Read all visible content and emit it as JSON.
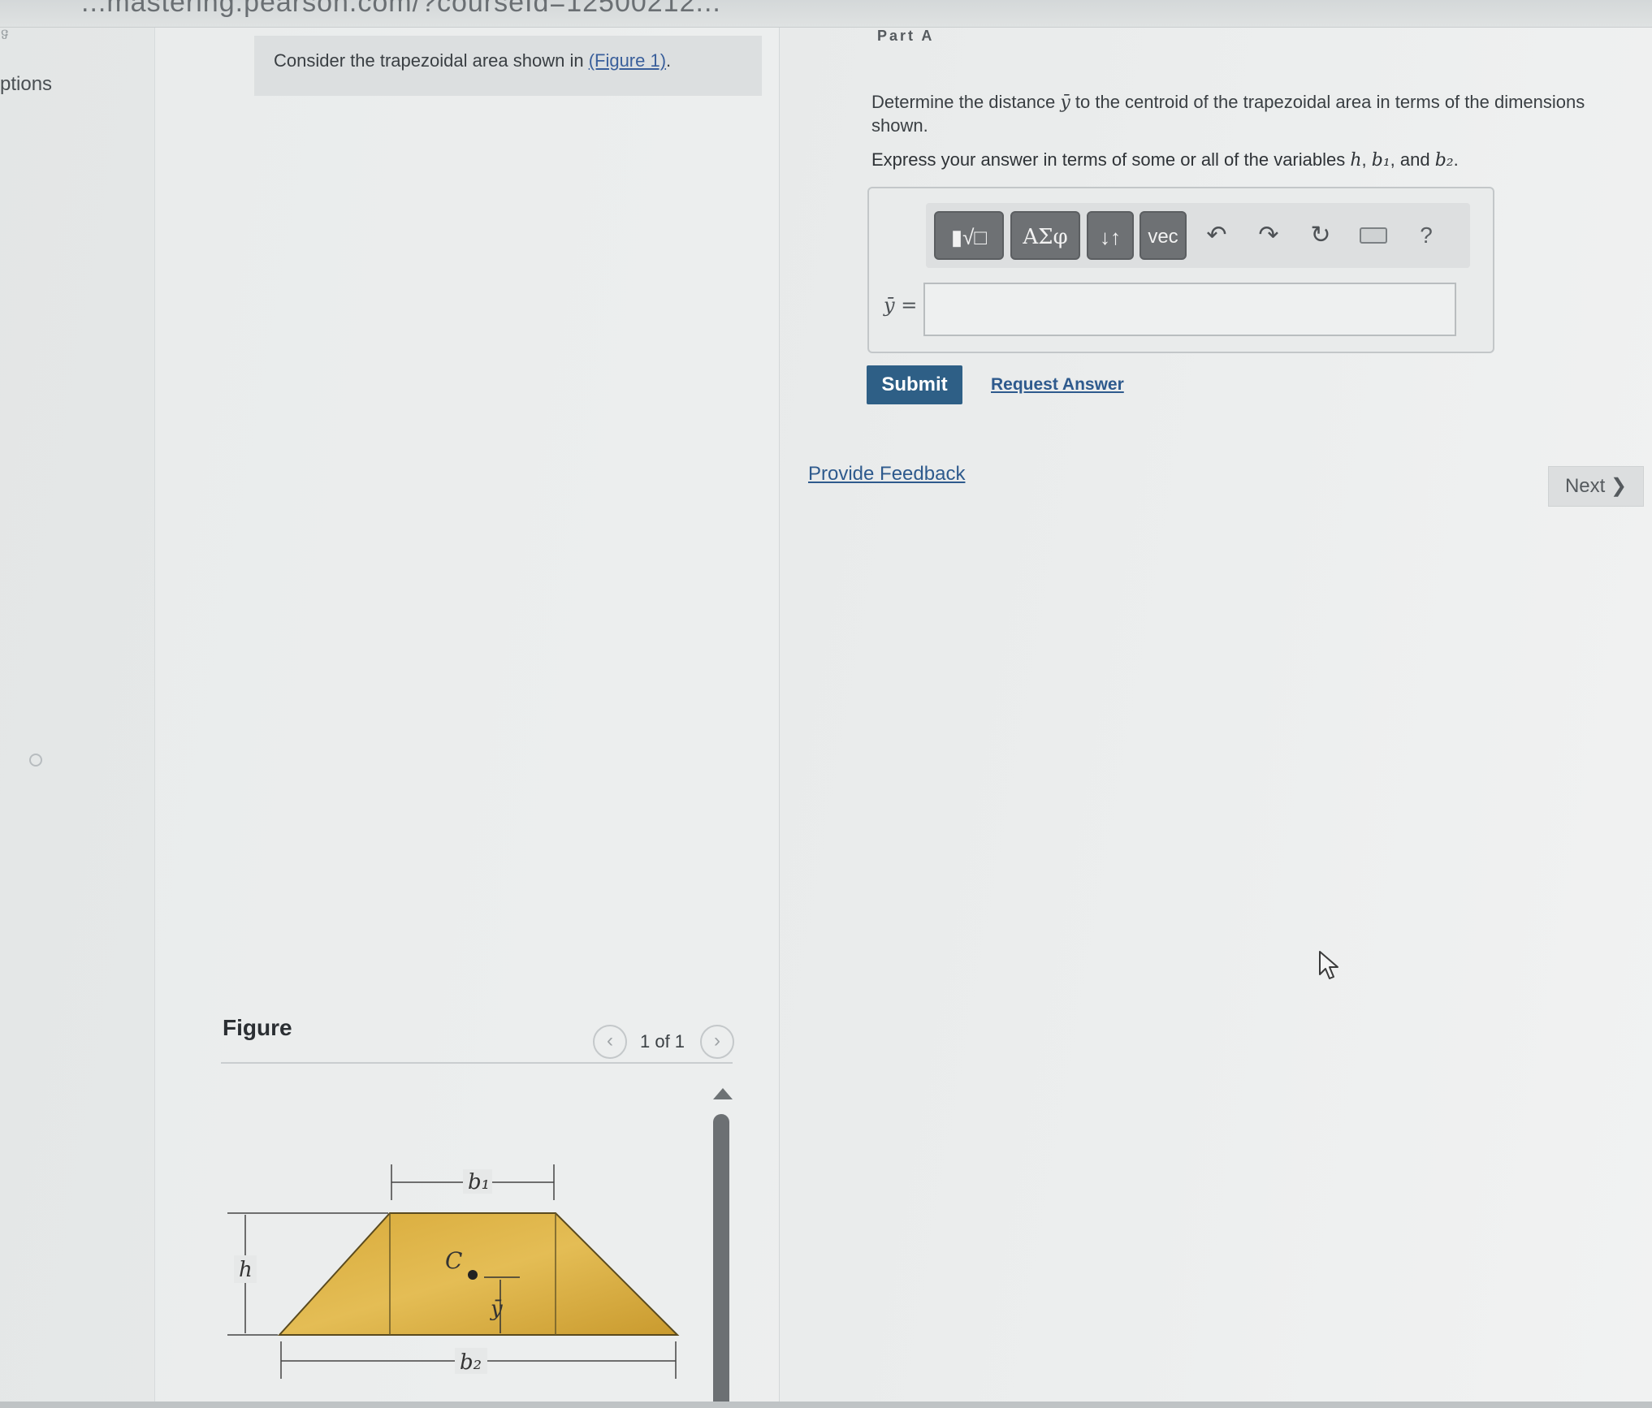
{
  "browser": {
    "url_fragment": "...mastering.pearson.com/?courseId=12500212...",
    "tab_mark": "ទ"
  },
  "sidebar": {
    "options_label": "ptions"
  },
  "problem": {
    "intro": "Consider the trapezoidal area shown in ",
    "figure_link": "(Figure 1)",
    "period": "."
  },
  "part": {
    "label": "Part A",
    "question_pre": "Determine the distance ",
    "question_var": "ȳ",
    "question_post": " to the centroid of the trapezoidal area in terms of the dimensions shown.",
    "express_pre": "Express your answer in terms of some or all of the variables ",
    "var_h": "h",
    "var_b1": "b₁",
    "var_b2": "b₂",
    "express_and": ", and ",
    "express_sep": ", ",
    "express_end": "."
  },
  "toolbar": {
    "templates_label": "▮√□",
    "greek_label": "ΑΣφ",
    "arrows_label": "↓↑",
    "vec_label": "vec",
    "undo_icon": "↶",
    "redo_icon": "↷",
    "reset_icon": "↻",
    "help_icon": "?"
  },
  "answer": {
    "label": "ȳ =",
    "value": ""
  },
  "actions": {
    "submit": "Submit",
    "request_answer": "Request Answer",
    "provide_feedback": "Provide Feedback",
    "next": "Next ❯"
  },
  "figure": {
    "title": "Figure",
    "page": "1 of 1",
    "prev": "‹",
    "next": "›",
    "labels": {
      "b1": "b₁",
      "b2": "b₂",
      "h": "h",
      "c": "C",
      "ybar": "ȳ"
    },
    "fill_color": "#d6a93a"
  }
}
